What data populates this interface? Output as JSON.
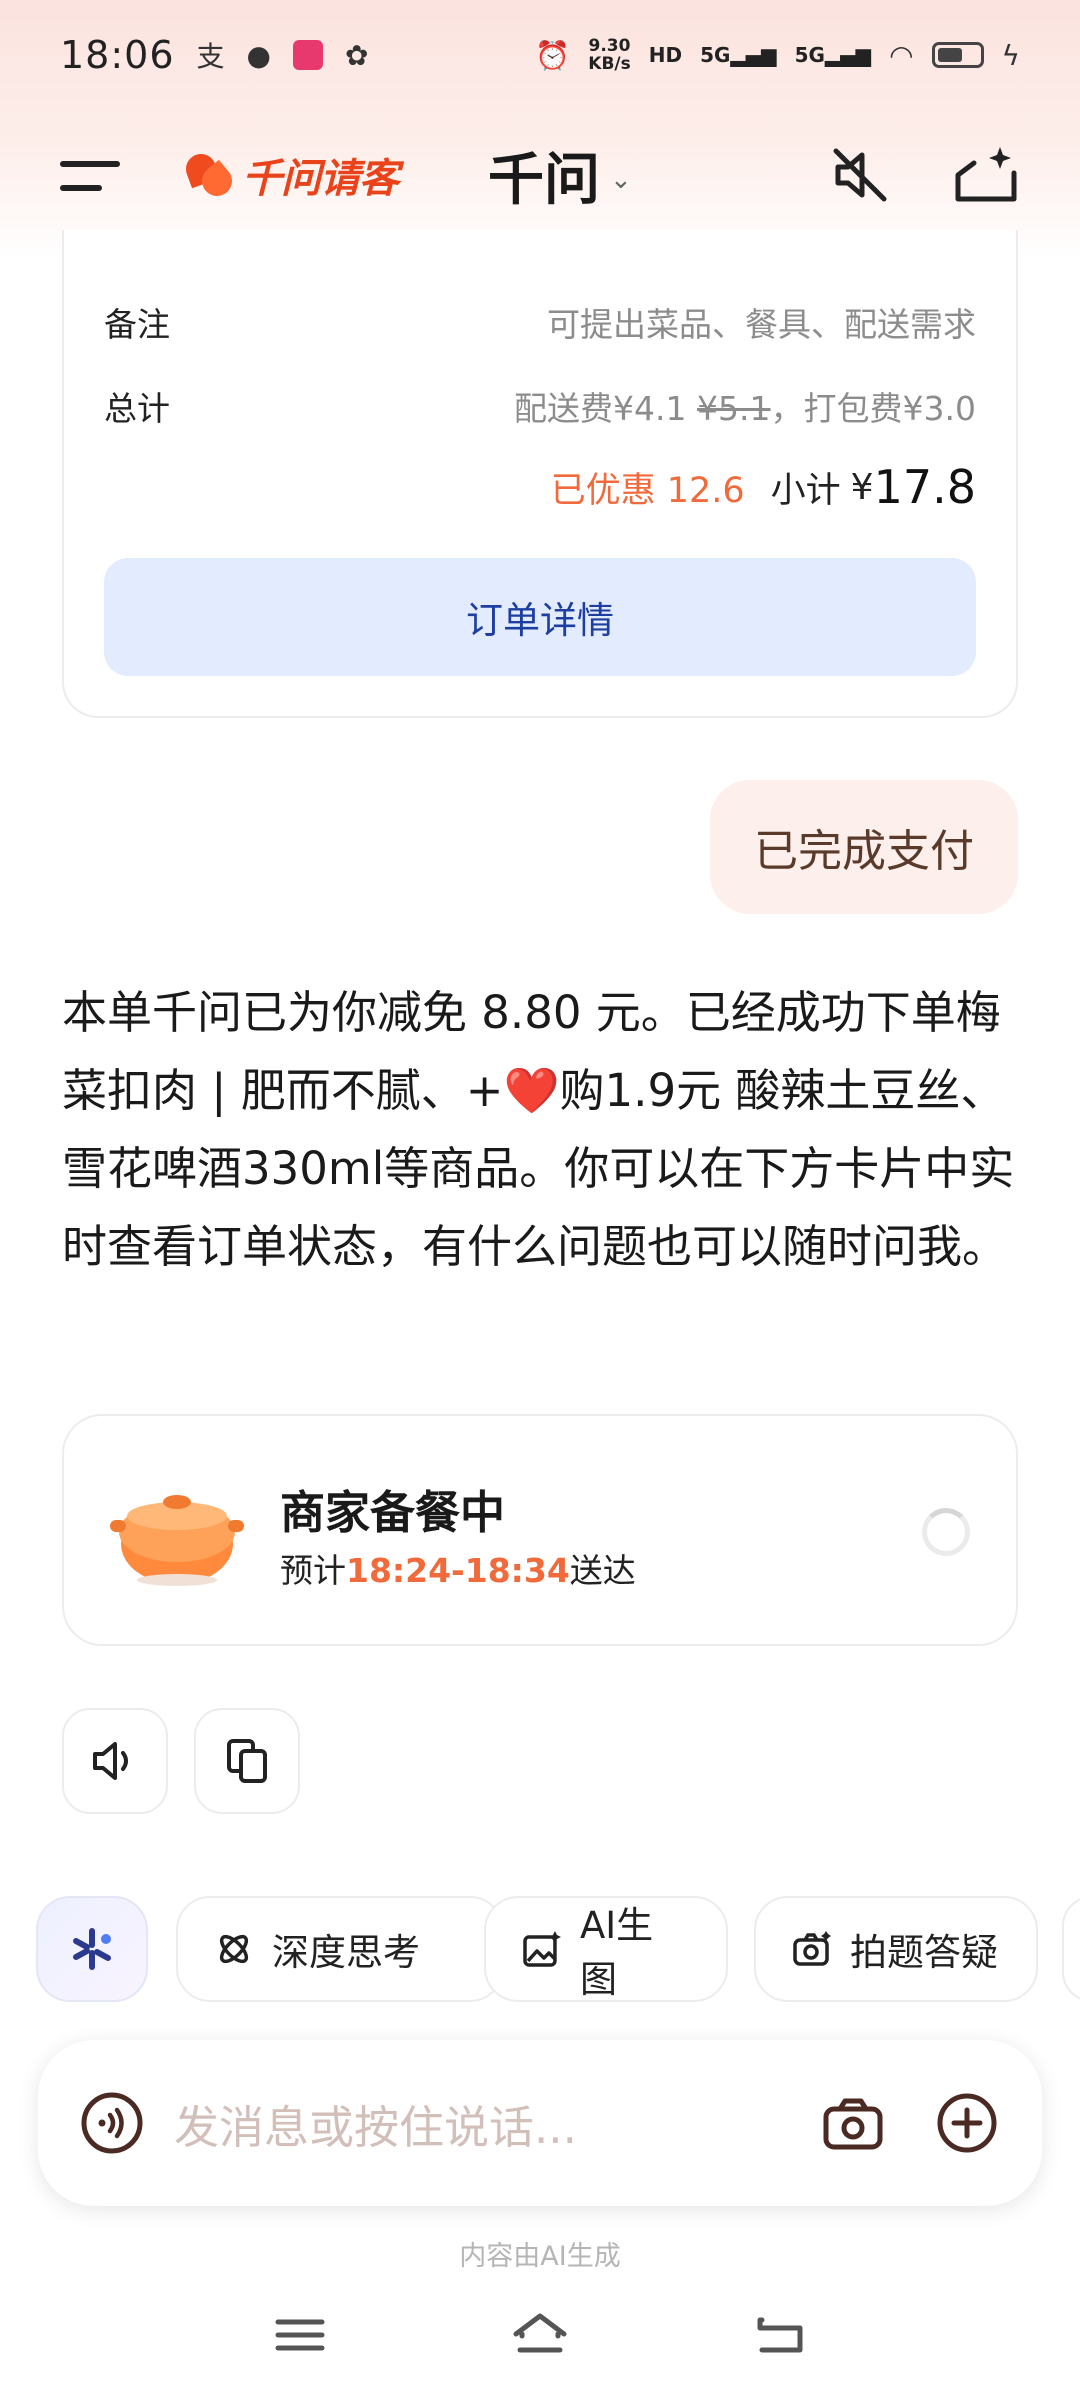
{
  "status_bar": {
    "time": "18:06",
    "net_speed_value": "9.30",
    "net_speed_unit": "KB/s",
    "sim1": "5G",
    "sim2": "5G"
  },
  "header": {
    "brand": "千问请客",
    "title": "千问",
    "chevron": "⌄"
  },
  "order_card": {
    "remark_label": "备注",
    "remark_placeholder": "可提出菜品、餐具、配送需求",
    "total_label": "总计",
    "delivery_fee": "配送费¥4.1",
    "delivery_fee_original": "¥5.1",
    "packing_fee": "，打包费¥3.0",
    "discount": "已优惠 12.6",
    "subtotal_label": "小计",
    "subtotal_currency": "¥",
    "subtotal_value": "17.8",
    "detail_button": "订单详情"
  },
  "user_message": "已完成支付",
  "assistant_message": {
    "part1": "本单千问已为你减免 8.80 元。已经成功下单梅菜扣肉 | 肥而不腻、+",
    "heart": "❤️",
    "part2": "购1.9元 酸辣土豆丝、雪花啤酒330ml等商品。你可以在下方卡片中实时查看订单状态，有什么问题也可以随时问我。"
  },
  "status_card": {
    "title": "商家备餐中",
    "eta_prefix": "预计",
    "eta_time": "18:24-18:34",
    "eta_suffix": "送达"
  },
  "tools": {
    "deep_think": "深度思考",
    "ai_image": "AI生图",
    "photo_qa": "拍题答疑"
  },
  "input": {
    "placeholder": "发消息或按住说话..."
  },
  "footer_note": "内容由AI生成",
  "colors": {
    "accent_orange": "#f06a3c",
    "brand_red": "#e8431a",
    "detail_button_bg": "#e3ebfe",
    "user_bubble_bg": "#fdefeb"
  }
}
